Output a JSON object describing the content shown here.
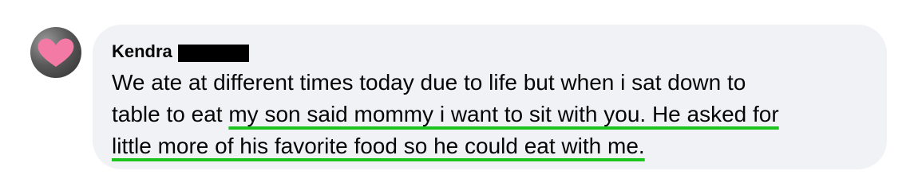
{
  "comment": {
    "author_name": "Kendra",
    "lines": [
      "We ate at different times today due to life but when i sat down to",
      "table to eat ",
      "my son said mommy i want to sit with you. He asked for",
      "little more of his favorite food so he could eat with me."
    ]
  },
  "avatar": {
    "icon": "heart-icon",
    "heart_color": "#f47aa6"
  },
  "colors": {
    "bubble_background": "#f0f2f5",
    "text": "#050505",
    "highlight_underline": "#1ec41e",
    "redaction": "#000000"
  }
}
